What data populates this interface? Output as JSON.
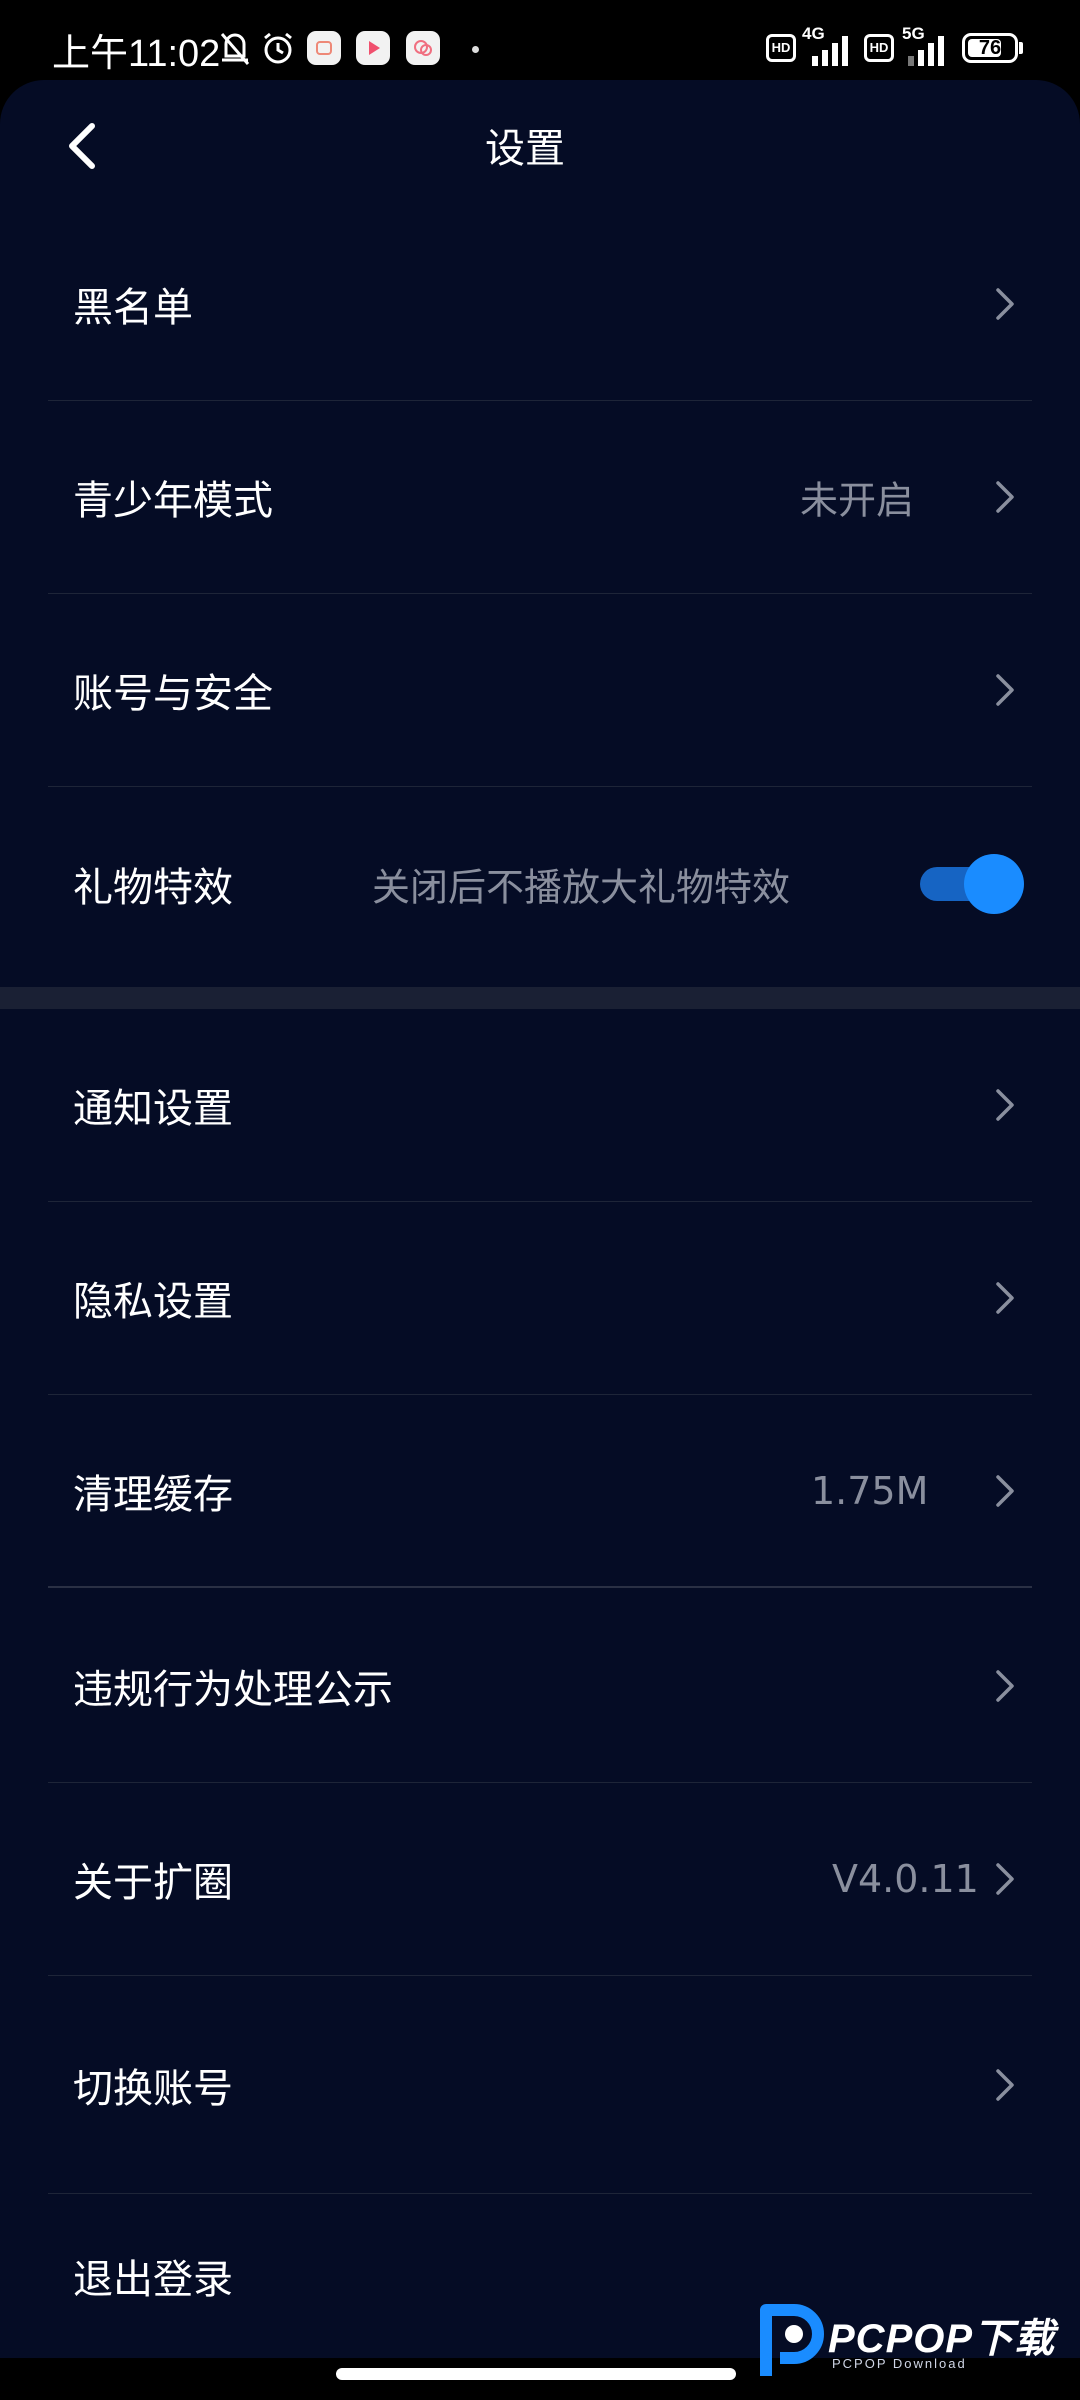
{
  "status_bar": {
    "time": "上午11:02",
    "network_1": "4G",
    "network_2": "5G",
    "hd_label": "HD",
    "battery_level": "76",
    "battery_percent": 76
  },
  "header": {
    "title": "设置"
  },
  "settings": {
    "blacklist": {
      "label": "黑名单"
    },
    "teen_mode": {
      "label": "青少年模式",
      "value": "未开启"
    },
    "account_security": {
      "label": "账号与安全"
    },
    "gift_effects": {
      "label": "礼物特效",
      "hint": "关闭后不播放大礼物特效",
      "enabled": true
    },
    "notifications": {
      "label": "通知设置"
    },
    "privacy": {
      "label": "隐私设置"
    },
    "clear_cache": {
      "label": "清理缓存",
      "value": "1.75M"
    },
    "violations": {
      "label": "违规行为处理公示"
    },
    "about": {
      "label": "关于扩圈",
      "value": "V4.0.11"
    },
    "switch_account": {
      "label": "切换账号"
    },
    "logout": {
      "label": "退出登录"
    }
  },
  "watermark": {
    "title": "PCPOP下载",
    "subtitle": "PCPOP Download"
  },
  "colors": {
    "background": "#050c25",
    "accent": "#1a8cff",
    "secondary_text": "#8a8f9e"
  }
}
